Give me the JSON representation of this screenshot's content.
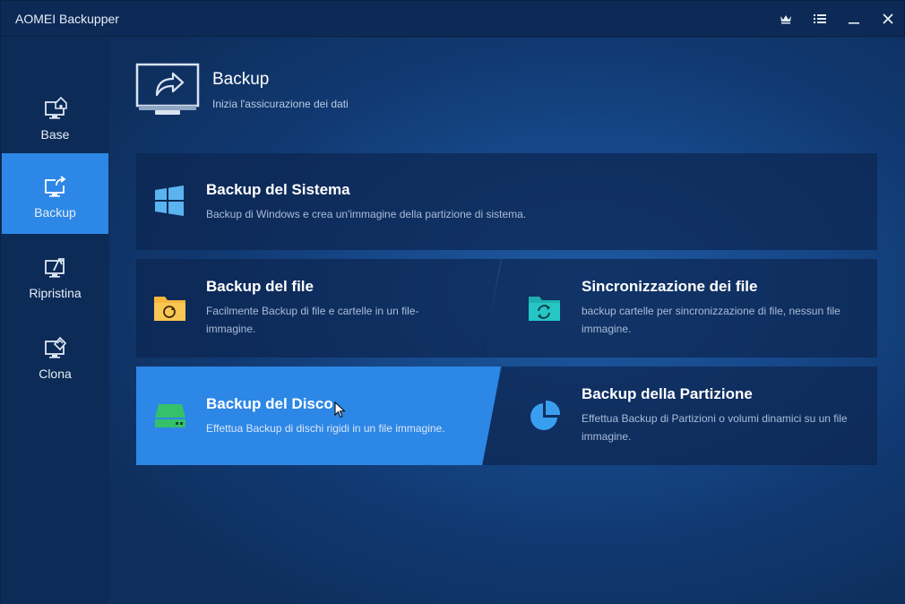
{
  "window": {
    "title": "AOMEI Backupper",
    "controls": [
      "crown-icon",
      "menu-icon",
      "minimize-icon",
      "close-icon"
    ]
  },
  "sidebar": {
    "items": [
      {
        "label": "Base",
        "icon": "home-monitor-icon",
        "active": false
      },
      {
        "label": "Backup",
        "icon": "backup-monitor-icon",
        "active": true
      },
      {
        "label": "Ripristina",
        "icon": "restore-monitor-icon",
        "active": false
      },
      {
        "label": "Clona",
        "icon": "clone-monitor-icon",
        "active": false
      }
    ]
  },
  "header": {
    "title": "Backup",
    "subtitle": "Inizia l'assicurazione dei dati",
    "icon": "monitor-share-icon"
  },
  "cards": {
    "system": {
      "title": "Backup del Sistema",
      "desc": "Backup di Windows e crea un'immagine della partizione di sistema.",
      "icon": "windows-icon"
    },
    "file": {
      "title": "Backup del file",
      "desc": "Facilmente Backup di file e cartelle in un file-immagine.",
      "icon": "folder-backup-icon"
    },
    "sync": {
      "title": "Sincronizzazione dei file",
      "desc": "backup cartelle per sincronizzazione di file, nessun file immagine.",
      "icon": "folder-sync-icon"
    },
    "disk": {
      "title": "Backup del Disco",
      "desc": "Effettua Backup di dischi rigidi in un file immagine.",
      "icon": "disk-icon",
      "highlighted": true
    },
    "partition": {
      "title": "Backup della Partizione",
      "desc": "Effettua Backup di Partizioni o volumi dinamici su un file immagine.",
      "icon": "pie-partition-icon"
    }
  },
  "colors": {
    "accent": "#2d87e6",
    "sidebar_bg": "#0c2b57",
    "folder_yellow": "#f6b73c",
    "sync_teal": "#26c6c6",
    "disk_green": "#35c06a",
    "windows_blue": "#5bb4ef"
  }
}
